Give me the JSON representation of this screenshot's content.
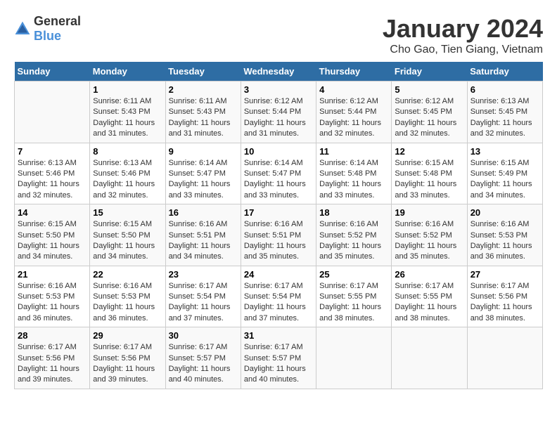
{
  "header": {
    "logo_general": "General",
    "logo_blue": "Blue",
    "title": "January 2024",
    "subtitle": "Cho Gao, Tien Giang, Vietnam"
  },
  "calendar": {
    "days_of_week": [
      "Sunday",
      "Monday",
      "Tuesday",
      "Wednesday",
      "Thursday",
      "Friday",
      "Saturday"
    ],
    "weeks": [
      [
        {
          "num": "",
          "text": ""
        },
        {
          "num": "1",
          "text": "Sunrise: 6:11 AM\nSunset: 5:43 PM\nDaylight: 11 hours and 31 minutes."
        },
        {
          "num": "2",
          "text": "Sunrise: 6:11 AM\nSunset: 5:43 PM\nDaylight: 11 hours and 31 minutes."
        },
        {
          "num": "3",
          "text": "Sunrise: 6:12 AM\nSunset: 5:44 PM\nDaylight: 11 hours and 31 minutes."
        },
        {
          "num": "4",
          "text": "Sunrise: 6:12 AM\nSunset: 5:44 PM\nDaylight: 11 hours and 32 minutes."
        },
        {
          "num": "5",
          "text": "Sunrise: 6:12 AM\nSunset: 5:45 PM\nDaylight: 11 hours and 32 minutes."
        },
        {
          "num": "6",
          "text": "Sunrise: 6:13 AM\nSunset: 5:45 PM\nDaylight: 11 hours and 32 minutes."
        }
      ],
      [
        {
          "num": "7",
          "text": "Sunrise: 6:13 AM\nSunset: 5:46 PM\nDaylight: 11 hours and 32 minutes."
        },
        {
          "num": "8",
          "text": "Sunrise: 6:13 AM\nSunset: 5:46 PM\nDaylight: 11 hours and 32 minutes."
        },
        {
          "num": "9",
          "text": "Sunrise: 6:14 AM\nSunset: 5:47 PM\nDaylight: 11 hours and 33 minutes."
        },
        {
          "num": "10",
          "text": "Sunrise: 6:14 AM\nSunset: 5:47 PM\nDaylight: 11 hours and 33 minutes."
        },
        {
          "num": "11",
          "text": "Sunrise: 6:14 AM\nSunset: 5:48 PM\nDaylight: 11 hours and 33 minutes."
        },
        {
          "num": "12",
          "text": "Sunrise: 6:15 AM\nSunset: 5:48 PM\nDaylight: 11 hours and 33 minutes."
        },
        {
          "num": "13",
          "text": "Sunrise: 6:15 AM\nSunset: 5:49 PM\nDaylight: 11 hours and 34 minutes."
        }
      ],
      [
        {
          "num": "14",
          "text": "Sunrise: 6:15 AM\nSunset: 5:50 PM\nDaylight: 11 hours and 34 minutes."
        },
        {
          "num": "15",
          "text": "Sunrise: 6:15 AM\nSunset: 5:50 PM\nDaylight: 11 hours and 34 minutes."
        },
        {
          "num": "16",
          "text": "Sunrise: 6:16 AM\nSunset: 5:51 PM\nDaylight: 11 hours and 34 minutes."
        },
        {
          "num": "17",
          "text": "Sunrise: 6:16 AM\nSunset: 5:51 PM\nDaylight: 11 hours and 35 minutes."
        },
        {
          "num": "18",
          "text": "Sunrise: 6:16 AM\nSunset: 5:52 PM\nDaylight: 11 hours and 35 minutes."
        },
        {
          "num": "19",
          "text": "Sunrise: 6:16 AM\nSunset: 5:52 PM\nDaylight: 11 hours and 35 minutes."
        },
        {
          "num": "20",
          "text": "Sunrise: 6:16 AM\nSunset: 5:53 PM\nDaylight: 11 hours and 36 minutes."
        }
      ],
      [
        {
          "num": "21",
          "text": "Sunrise: 6:16 AM\nSunset: 5:53 PM\nDaylight: 11 hours and 36 minutes."
        },
        {
          "num": "22",
          "text": "Sunrise: 6:16 AM\nSunset: 5:53 PM\nDaylight: 11 hours and 36 minutes."
        },
        {
          "num": "23",
          "text": "Sunrise: 6:17 AM\nSunset: 5:54 PM\nDaylight: 11 hours and 37 minutes."
        },
        {
          "num": "24",
          "text": "Sunrise: 6:17 AM\nSunset: 5:54 PM\nDaylight: 11 hours and 37 minutes."
        },
        {
          "num": "25",
          "text": "Sunrise: 6:17 AM\nSunset: 5:55 PM\nDaylight: 11 hours and 38 minutes."
        },
        {
          "num": "26",
          "text": "Sunrise: 6:17 AM\nSunset: 5:55 PM\nDaylight: 11 hours and 38 minutes."
        },
        {
          "num": "27",
          "text": "Sunrise: 6:17 AM\nSunset: 5:56 PM\nDaylight: 11 hours and 38 minutes."
        }
      ],
      [
        {
          "num": "28",
          "text": "Sunrise: 6:17 AM\nSunset: 5:56 PM\nDaylight: 11 hours and 39 minutes."
        },
        {
          "num": "29",
          "text": "Sunrise: 6:17 AM\nSunset: 5:56 PM\nDaylight: 11 hours and 39 minutes."
        },
        {
          "num": "30",
          "text": "Sunrise: 6:17 AM\nSunset: 5:57 PM\nDaylight: 11 hours and 40 minutes."
        },
        {
          "num": "31",
          "text": "Sunrise: 6:17 AM\nSunset: 5:57 PM\nDaylight: 11 hours and 40 minutes."
        },
        {
          "num": "",
          "text": ""
        },
        {
          "num": "",
          "text": ""
        },
        {
          "num": "",
          "text": ""
        }
      ]
    ]
  }
}
